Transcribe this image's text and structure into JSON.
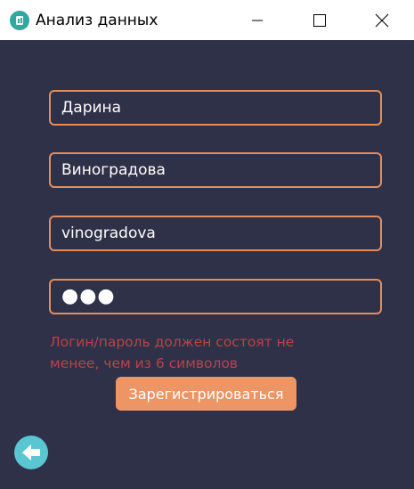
{
  "window": {
    "title": "Анализ данных",
    "icon": "app-chart-icon",
    "controls": [
      "minimize-icon",
      "maximize-icon",
      "close-icon"
    ]
  },
  "form": {
    "first_name": "Дарина",
    "last_name": "Виноградова",
    "login": "vinogradova",
    "password_mask": "●●●"
  },
  "error_message": "Логин/пароль должен состоят не менее, чем из 6 символов",
  "register_button": "Зарегистрироваться",
  "back_button_icon": "arrow-left-icon",
  "colors": {
    "background": "#2f3148",
    "accent": "#e38d5c",
    "button": "#ed9564",
    "error": "#b8444a",
    "back_button": "#59c6d1"
  }
}
